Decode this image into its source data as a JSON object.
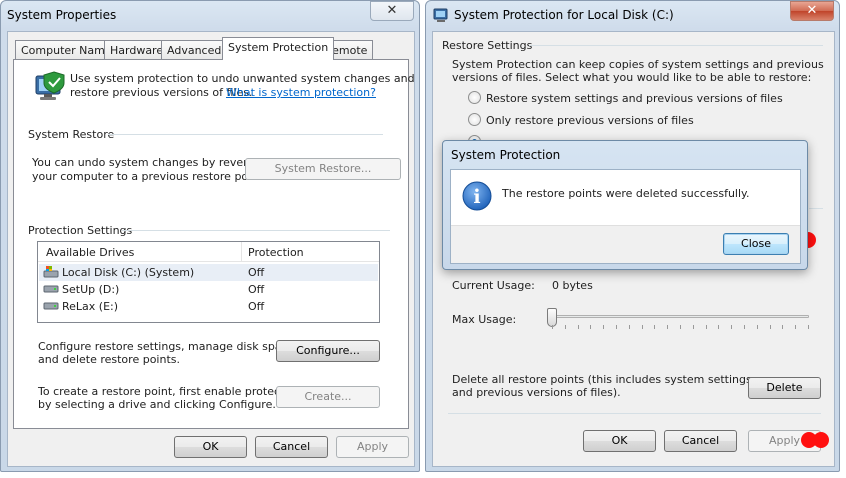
{
  "system_properties": {
    "title": "System Properties",
    "close_glyph": "✕",
    "tabs": [
      "Computer Name",
      "Hardware",
      "Advanced",
      "System Protection",
      "Remote"
    ],
    "intro_line1": "Use system protection to undo unwanted system changes and",
    "intro_line2": "restore previous versions of files.",
    "intro_link": "What is system protection?",
    "system_restore": {
      "heading": "System Restore",
      "desc_line1": "You can undo system changes by reverting",
      "desc_line2": "your computer to a previous restore point.",
      "button": "System Restore..."
    },
    "protection_settings": {
      "heading": "Protection Settings",
      "columns": [
        "Available Drives",
        "Protection"
      ],
      "drives": [
        {
          "name": "Local Disk (C:) (System)",
          "protection": "Off"
        },
        {
          "name": "SetUp (D:)",
          "protection": "Off"
        },
        {
          "name": "ReLax (E:)",
          "protection": "Off"
        }
      ],
      "configure_line1": "Configure restore settings, manage disk space,",
      "configure_line2": "and delete restore points.",
      "configure_button": "Configure...",
      "create_line1": "To create a restore point, first enable protection",
      "create_line2": "by selecting a drive and clicking Configure.",
      "create_button": "Create..."
    },
    "footer": {
      "ok": "OK",
      "cancel": "Cancel",
      "apply": "Apply"
    }
  },
  "protection_window": {
    "title": "System Protection for Local Disk (C:)",
    "close_glyph": "✕",
    "restore_settings": {
      "heading": "Restore Settings",
      "desc_line1": "System Protection can keep copies of system settings and previous",
      "desc_line2": "versions of files. Select what you would like to be able to restore:",
      "options": [
        "Restore system settings and previous versions of files",
        "Only restore previous versions of files"
      ]
    },
    "current_usage_label": "Current Usage:",
    "current_usage_value": "0 bytes",
    "max_usage_label": "Max Usage:",
    "max_usage_level_fraction": 0,
    "delete_line1": "Delete all restore points (this includes system settings",
    "delete_line2": "and previous versions of files).",
    "delete_button": "Delete",
    "footer": {
      "ok": "OK",
      "cancel": "Cancel",
      "apply": "Apply"
    }
  },
  "message_dialog": {
    "title": "System Protection",
    "info_glyph": "i",
    "message": "The restore points were deleted successfully.",
    "close_button": "Close"
  },
  "colors": {
    "marker": "#ff1010",
    "link": "#0066cc",
    "info_icon": "#1b5fb8"
  }
}
